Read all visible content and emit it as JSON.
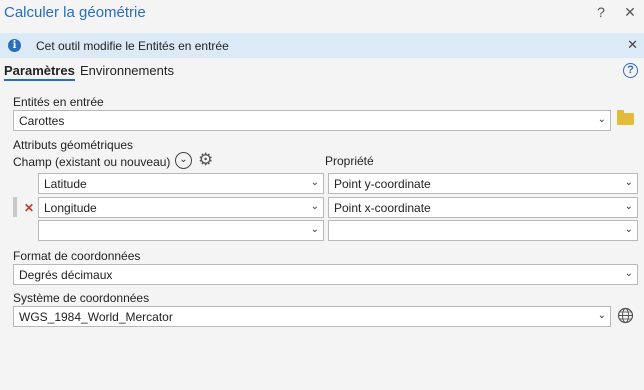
{
  "window": {
    "title": "Calculer la géométrie",
    "help_glyph": "?",
    "close_glyph": "✕"
  },
  "banner": {
    "icon": "info-icon",
    "icon_glyph": "i",
    "message": "Cet outil modifie le Entités en entrée",
    "close_glyph": "✕"
  },
  "tabs": {
    "parameters": "Paramètres",
    "environments": "Environnements",
    "help_glyph": "?"
  },
  "input_features": {
    "label": "Entités en entrée",
    "value": "Carottes",
    "browse_icon": "folder-icon"
  },
  "geometry_attributes": {
    "label": "Attributs géométriques",
    "field_header": "Champ (existant ou nouveau)",
    "property_header": "Propriété",
    "rows": [
      {
        "field": "Latitude",
        "property": "Point y-coordinate"
      },
      {
        "field": "Longitude",
        "property": "Point x-coordinate"
      },
      {
        "field": "",
        "property": ""
      }
    ],
    "remove_glyph": "✕"
  },
  "coordinate_format": {
    "label": "Format de coordonnées",
    "value": "Degrés décimaux"
  },
  "coordinate_system": {
    "label": "Système de coordonnées",
    "value": "WGS_1984_World_Mercator",
    "globe_icon": "globe-icon"
  },
  "colors": {
    "accent": "#2a6ebb",
    "banner_bg": "#dce9f6",
    "folder": "#e2bb3a",
    "remove": "#c0392b"
  }
}
